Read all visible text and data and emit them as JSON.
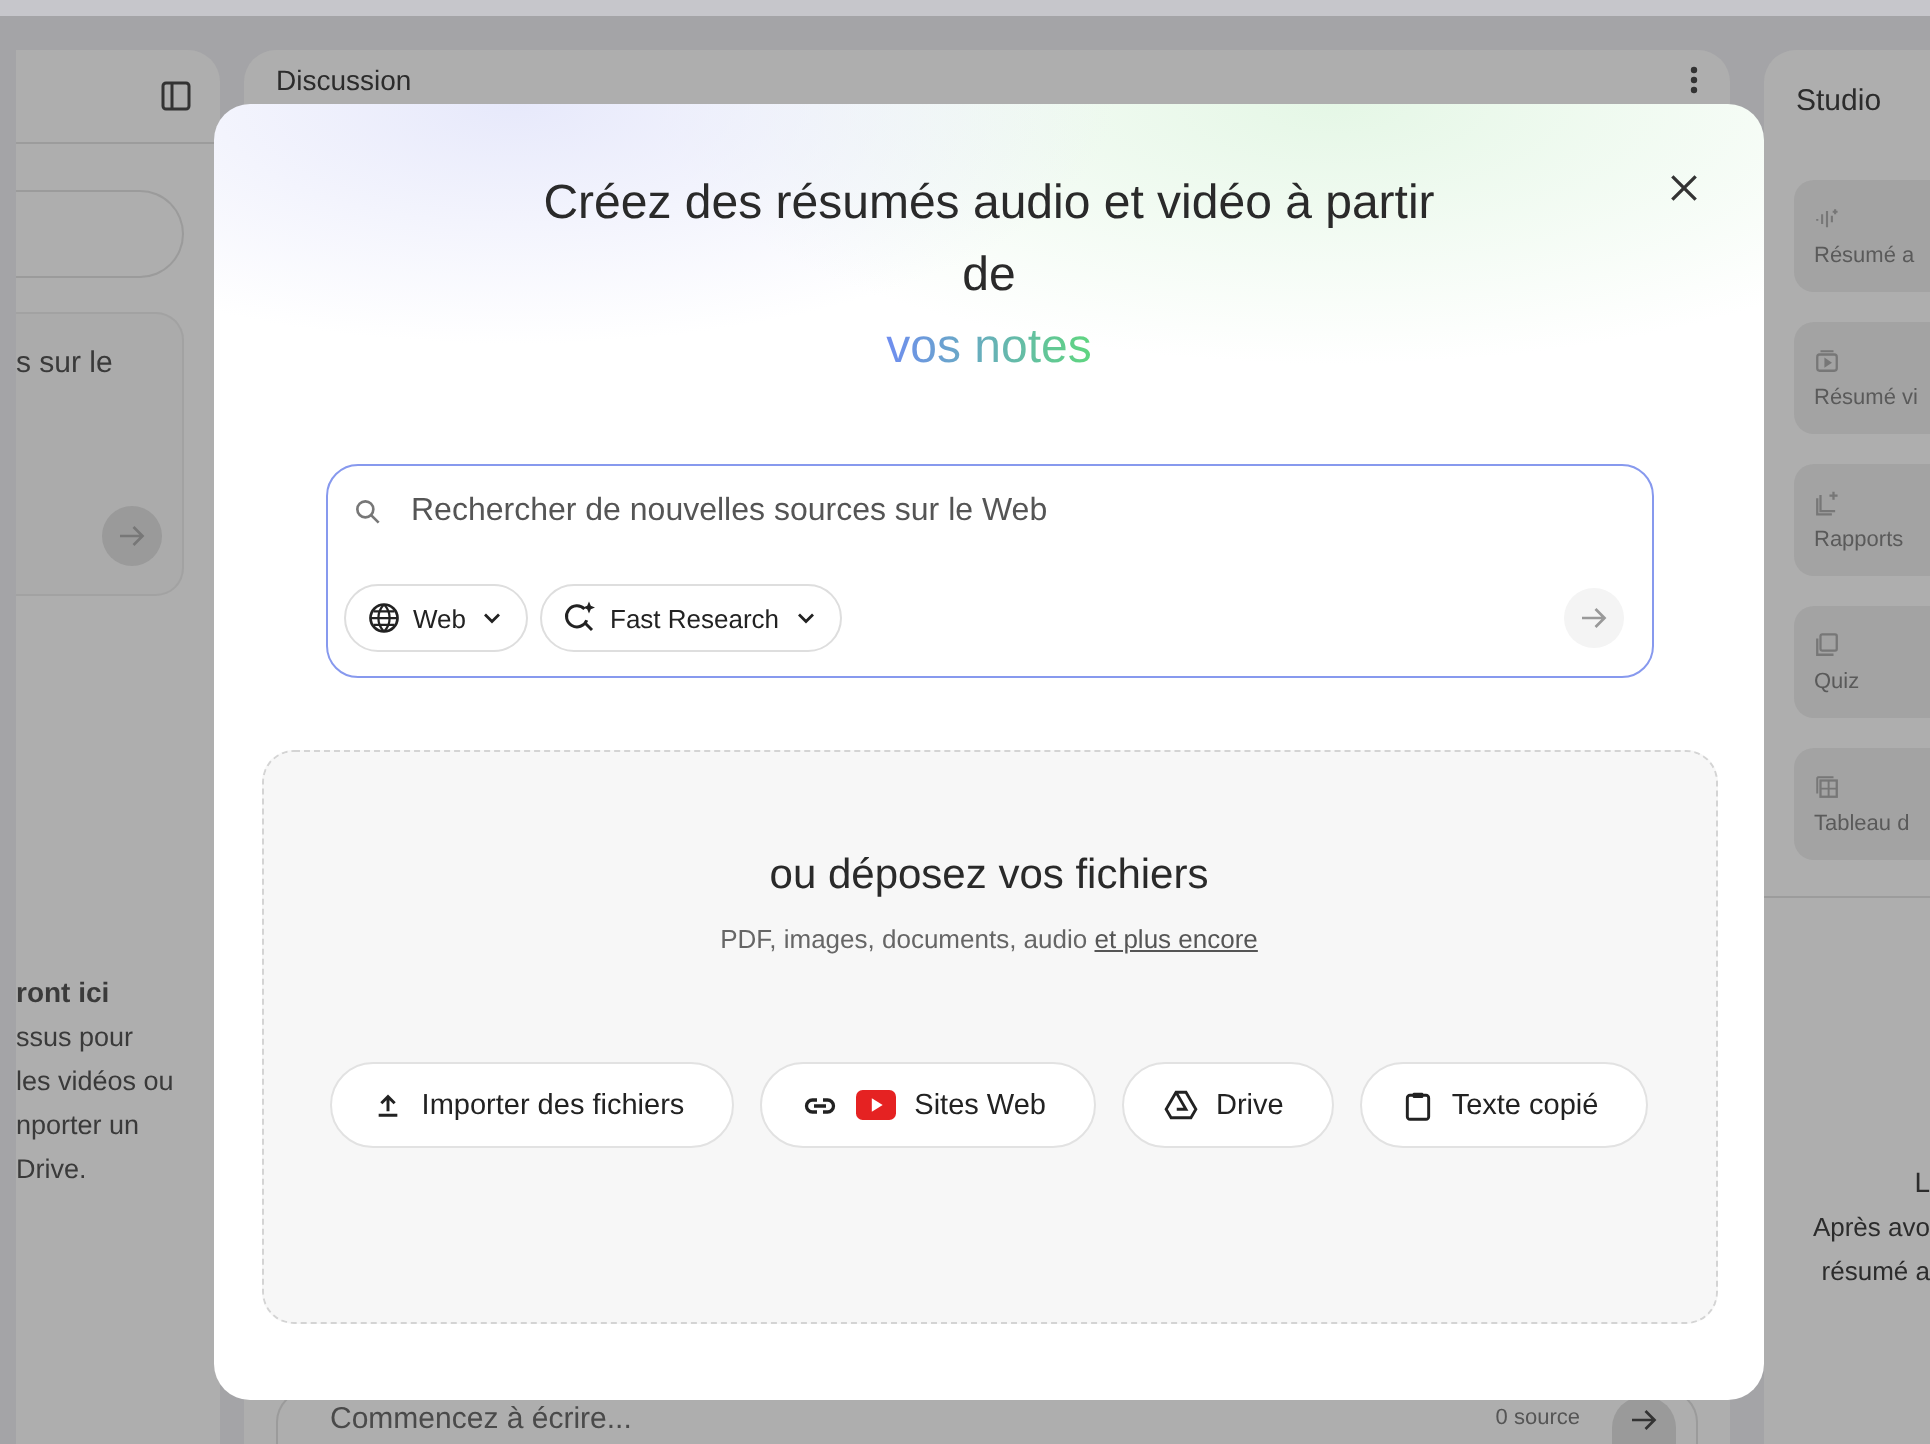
{
  "left_panel": {
    "card_text": "s sur le",
    "empty_title": "ront ici",
    "empty_lines": [
      "ssus pour",
      "les vidéos ou",
      "nporter un",
      "Drive."
    ]
  },
  "chat_panel": {
    "title": "Discussion",
    "input_placeholder": "Commencez à écrire...",
    "source_count": "0 source"
  },
  "studio_panel": {
    "title": "Studio",
    "tiles": [
      {
        "label": "Résumé a",
        "kind": "audio"
      },
      {
        "label": "Résumé vi",
        "kind": "video"
      },
      {
        "label": "Rapports",
        "kind": "report"
      },
      {
        "label": "Quiz",
        "kind": "quiz"
      },
      {
        "label": "Tableau d",
        "kind": "table"
      }
    ],
    "empty_lines": [
      "L",
      "Après avo",
      "résumé a"
    ]
  },
  "dialog": {
    "title_lines": [
      "Créez des résumés audio et vidéo à partir",
      "de"
    ],
    "title_highlight": "vos notes",
    "search": {
      "placeholder": "Rechercher de nouvelles sources sur le Web",
      "chips": [
        {
          "label": "Web",
          "kind": "web"
        },
        {
          "label": "Fast Research",
          "kind": "research"
        }
      ]
    },
    "dropzone": {
      "heading": "ou déposez vos fichiers",
      "hint": "PDF, images, documents, audio",
      "link": "et plus encore",
      "buttons": [
        {
          "label": "Importer des fichiers",
          "kind": "upload"
        },
        {
          "label": "Sites Web",
          "kind": "websites"
        },
        {
          "label": "Drive",
          "kind": "drive"
        },
        {
          "label": "Texte copié",
          "kind": "clipboard"
        }
      ]
    }
  }
}
